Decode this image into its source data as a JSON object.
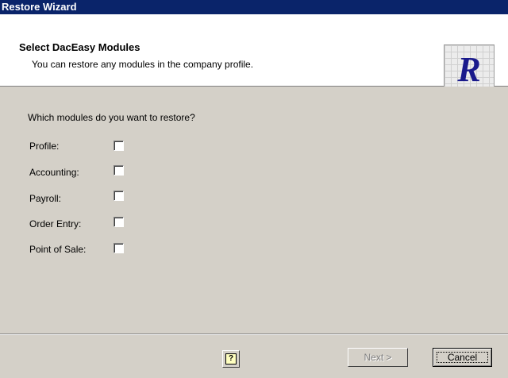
{
  "window": {
    "title": "Restore Wizard"
  },
  "header": {
    "title": "Select DacEasy Modules",
    "subtitle": "You can restore any modules in the company profile.",
    "logo_letter": "R"
  },
  "question": "Which modules do you want to restore?",
  "modules": [
    {
      "label": "Profile:",
      "checked": false
    },
    {
      "label": "Accounting:",
      "checked": false
    },
    {
      "label": "Payroll:",
      "checked": false
    },
    {
      "label": "Order Entry:",
      "checked": false
    },
    {
      "label": "Point of Sale:",
      "checked": false
    }
  ],
  "buttons": {
    "help_label": "?",
    "next_label": "Next >",
    "next_enabled": false,
    "cancel_label": "Cancel"
  }
}
